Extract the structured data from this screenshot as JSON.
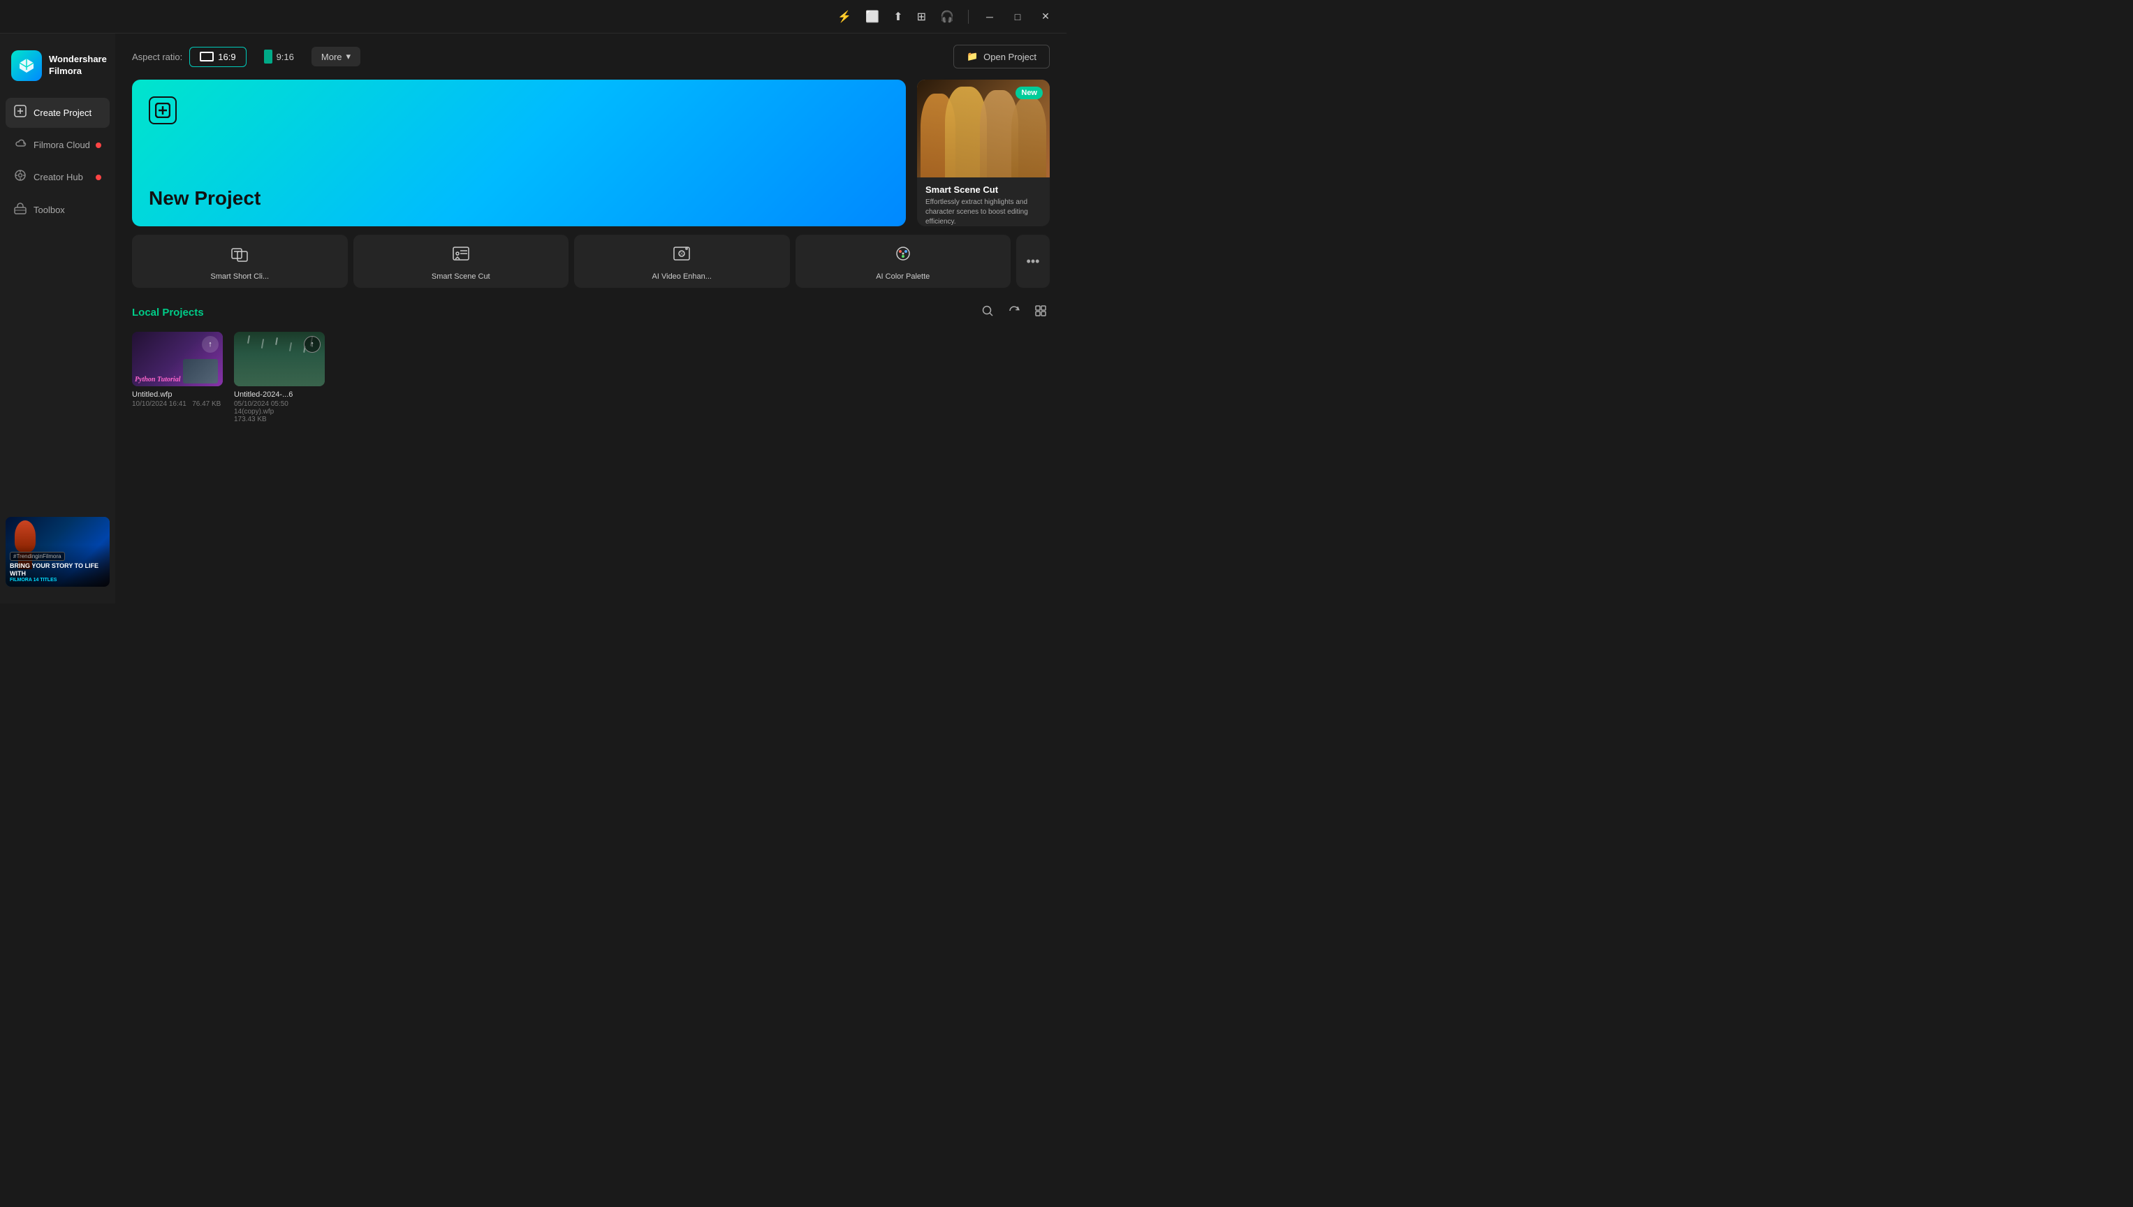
{
  "app": {
    "name": "Wondershare Filmora",
    "logo_text_line1": "Wondershare",
    "logo_text_line2": "Filmora"
  },
  "titlebar": {
    "icons": [
      "send-icon",
      "caption-icon",
      "upload-icon",
      "grid-icon",
      "headphone-icon"
    ],
    "controls": [
      "minimize-label",
      "maximize-label",
      "close-label"
    ]
  },
  "sidebar": {
    "items": [
      {
        "id": "create-project",
        "label": "Create Project",
        "icon": "➕",
        "active": true,
        "dot": false
      },
      {
        "id": "filmora-cloud",
        "label": "Filmora Cloud",
        "icon": "☁",
        "active": false,
        "dot": true
      },
      {
        "id": "creator-hub",
        "label": "Creator Hub",
        "icon": "💡",
        "active": false,
        "dot": true
      },
      {
        "id": "toolbox",
        "label": "Toolbox",
        "icon": "🧰",
        "active": false,
        "dot": false
      }
    ],
    "promo": {
      "tag": "#TrendinginFilmora",
      "line1": "BRING YOUR STORY TO LIFE WITH",
      "line2": "FILMORA 14",
      "line3": "TITLES"
    }
  },
  "topbar": {
    "aspect_label": "Aspect ratio:",
    "aspect_options": [
      {
        "id": "16:9",
        "label": "16:9",
        "active": true
      },
      {
        "id": "9:16",
        "label": "9:16",
        "active": false
      }
    ],
    "more_label": "More",
    "open_project_label": "Open Project"
  },
  "new_project": {
    "title": "New Project"
  },
  "feature_card": {
    "badge": "New",
    "title": "Smart Scene Cut",
    "description": "Effortlessly extract highlights and character scenes to boost editing efficiency.",
    "dots": 6,
    "active_dot": 1
  },
  "quicktools": {
    "items": [
      {
        "id": "smart-short-clip",
        "label": "Smart Short Cli...",
        "icon": "⬛"
      },
      {
        "id": "smart-scene-cut",
        "label": "Smart Scene Cut",
        "icon": "🎬"
      },
      {
        "id": "ai-video-enhance",
        "label": "AI Video Enhan...",
        "icon": "✨"
      },
      {
        "id": "ai-color-palette",
        "label": "AI Color Palette",
        "icon": "🎨"
      }
    ],
    "more_icon": "•••"
  },
  "local_projects": {
    "title": "Local Projects",
    "projects": [
      {
        "id": "proj1",
        "name": "Untitled.wfp",
        "date": "10/10/2024 16:41",
        "size": "76.47 KB",
        "thumb_type": "python"
      },
      {
        "id": "proj2",
        "name": "Untitled-2024-...6",
        "date": "05/10/2024 05:50",
        "size": "14(copy).wfp",
        "sub": "173.43 KB",
        "thumb_type": "rain"
      }
    ]
  }
}
